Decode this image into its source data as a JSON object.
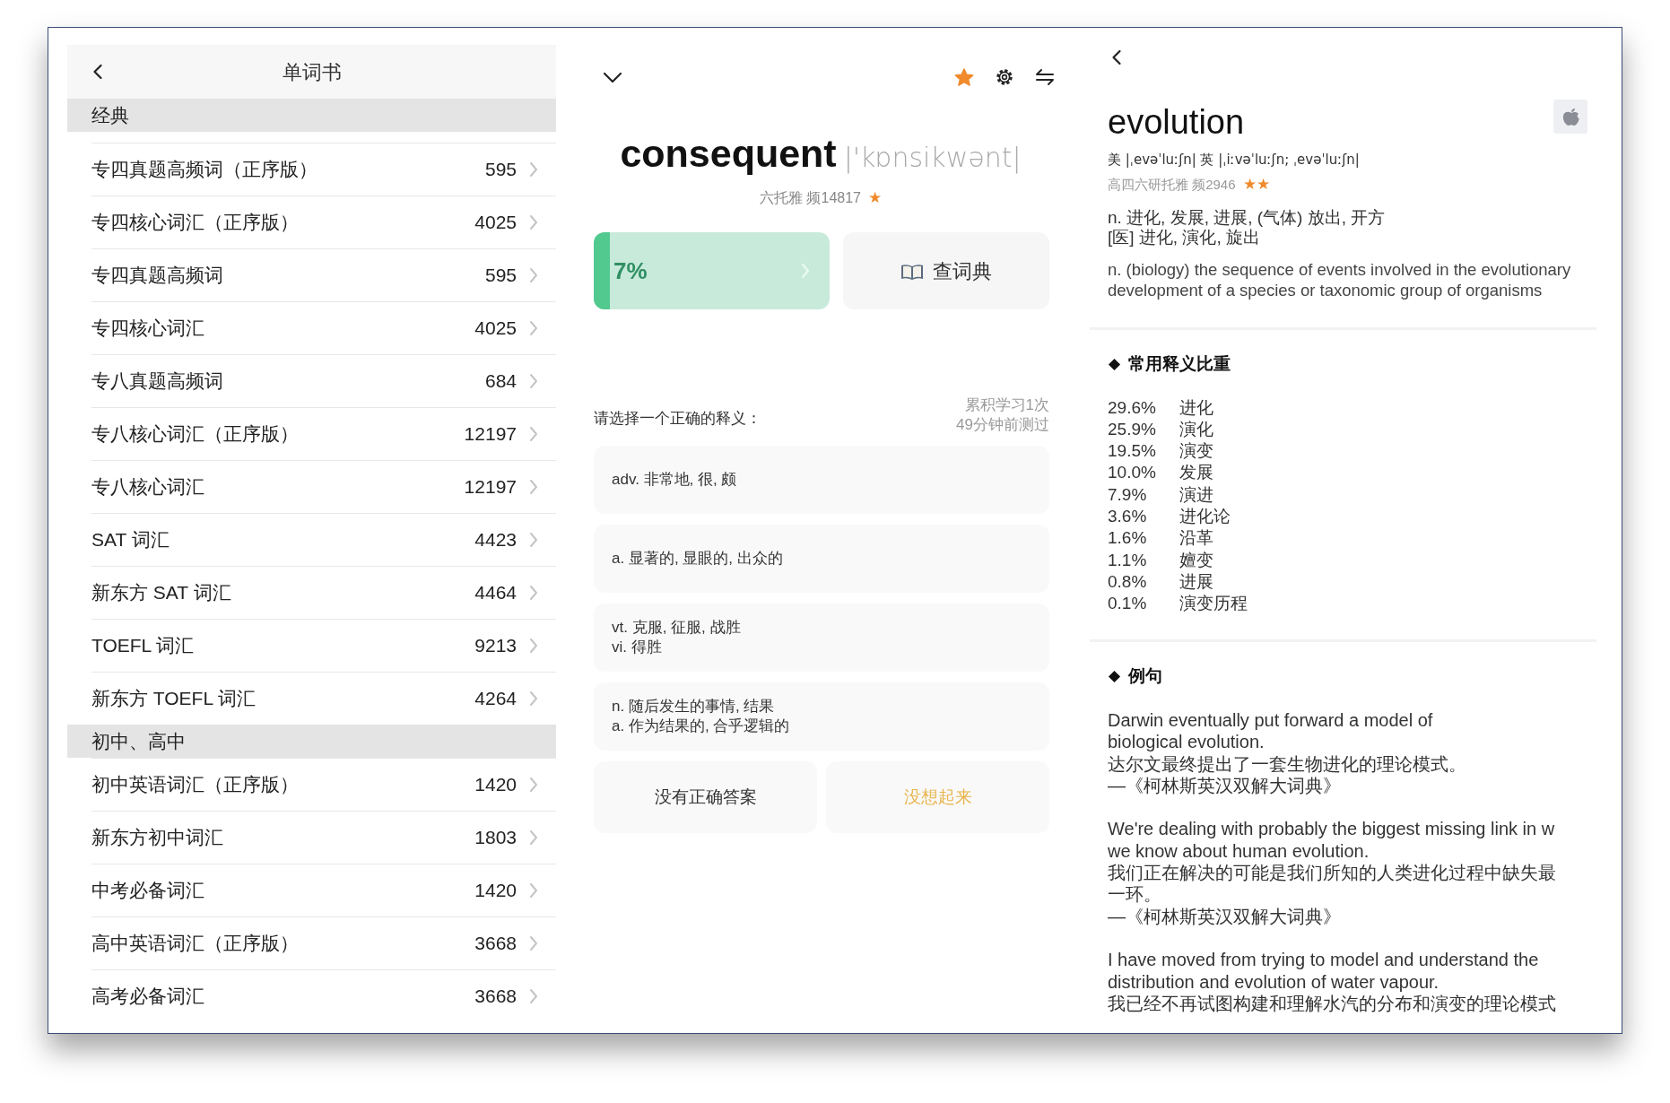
{
  "wordbook": {
    "title": "单词书",
    "sections": [
      {
        "title": "经典",
        "books": [
          {
            "name": "专四真题高频词（正序版）",
            "count": "595"
          },
          {
            "name": "专四核心词汇（正序版）",
            "count": "4025"
          },
          {
            "name": "专四真题高频词",
            "count": "595"
          },
          {
            "name": "专四核心词汇",
            "count": "4025"
          },
          {
            "name": "专八真题高频词",
            "count": "684"
          },
          {
            "name": "专八核心词汇（正序版）",
            "count": "12197"
          },
          {
            "name": "专八核心词汇",
            "count": "12197"
          },
          {
            "name": "SAT 词汇",
            "count": "4423"
          },
          {
            "name": "新东方 SAT 词汇",
            "count": "4464"
          },
          {
            "name": "TOEFL 词汇",
            "count": "9213"
          },
          {
            "name": "新东方 TOEFL 词汇",
            "count": "4264"
          }
        ]
      },
      {
        "title": "初中、高中",
        "books": [
          {
            "name": "初中英语词汇（正序版）",
            "count": "1420"
          },
          {
            "name": "新东方初中词汇",
            "count": "1803"
          },
          {
            "name": "中考必备词汇",
            "count": "1420"
          },
          {
            "name": "高中英语词汇（正序版）",
            "count": "3668"
          },
          {
            "name": "高考必备词汇",
            "count": "3668"
          }
        ]
      }
    ]
  },
  "quiz": {
    "favorited": true,
    "word": "consequent",
    "phonetic": "|'kɒnsikwənt|",
    "tags": "六托雅 频14817",
    "star_marks": "★",
    "progress": {
      "label": "7%",
      "level": 0.07
    },
    "dictionary_button": "查词典",
    "prompt": "请选择一个正确的释义：",
    "stats": [
      "累积学习1次",
      "49分钟前测过"
    ],
    "options": [
      {
        "lines": [
          "adv. 非常地, 很, 颇"
        ]
      },
      {
        "lines": [
          "a. 显著的, 显眼的, 出众的"
        ]
      },
      {
        "lines": [
          "vt. 克服, 征服, 战胜",
          "vi. 得胜"
        ]
      },
      {
        "lines": [
          "n. 随后发生的事情, 结果",
          "a. 作为结果的, 合乎逻辑的"
        ]
      }
    ],
    "buttons": [
      {
        "label": "没有正确答案",
        "kind": "plain"
      },
      {
        "label": "没想起来",
        "kind": "accent"
      }
    ]
  },
  "entry": {
    "word": "evolution",
    "phonetics": "美 |ˌevəˈluːʃn| 英 |ˌiːvəˈluːʃn; ˌevəˈluːʃn|",
    "tags": "高四六研托雅 频2946",
    "star_marks": "★★",
    "definitions": [
      "n. 进化, 发展, 进展, (气体) 放出, 开方",
      "[医] 进化, 演化, 旋出"
    ],
    "english_definition": "n. (biology) the sequence of events involved in the evolutionary development of a species or taxonomic group of organisms",
    "sense_weights": {
      "heading": "常用释义比重",
      "items": [
        {
          "percent": "29.6%",
          "meaning": "进化"
        },
        {
          "percent": "25.9%",
          "meaning": "演化"
        },
        {
          "percent": "19.5%",
          "meaning": "演变"
        },
        {
          "percent": "10.0%",
          "meaning": "发展"
        },
        {
          "percent": "7.9%",
          "meaning": "演进"
        },
        {
          "percent": "3.6%",
          "meaning": "进化论"
        },
        {
          "percent": "1.6%",
          "meaning": "沿革"
        },
        {
          "percent": "1.1%",
          "meaning": "嬗变"
        },
        {
          "percent": "0.8%",
          "meaning": "进展"
        },
        {
          "percent": "0.1%",
          "meaning": "演变历程"
        }
      ]
    },
    "examples": {
      "heading": "例句",
      "items": [
        {
          "en": [
            "Darwin eventually put forward a model of",
            "biological evolution."
          ],
          "zh": [
            "达尔文最终提出了一套生物进化的理论模式。"
          ],
          "source": "—《柯林斯英汉双解大词典》"
        },
        {
          "en": [
            "We're dealing with probably the biggest missing link in w",
            "we know about human evolution."
          ],
          "zh": [
            "我们正在解决的可能是我们所知的人类进化过程中缺失最",
            "一环。"
          ],
          "source": "—《柯林斯英汉双解大词典》"
        },
        {
          "en": [
            "I have moved from trying to model and understand the",
            "distribution and evolution of water vapour."
          ],
          "zh": [
            "我已经不再试图构建和理解水汽的分布和演变的理论模式"
          ]
        }
      ]
    }
  }
}
